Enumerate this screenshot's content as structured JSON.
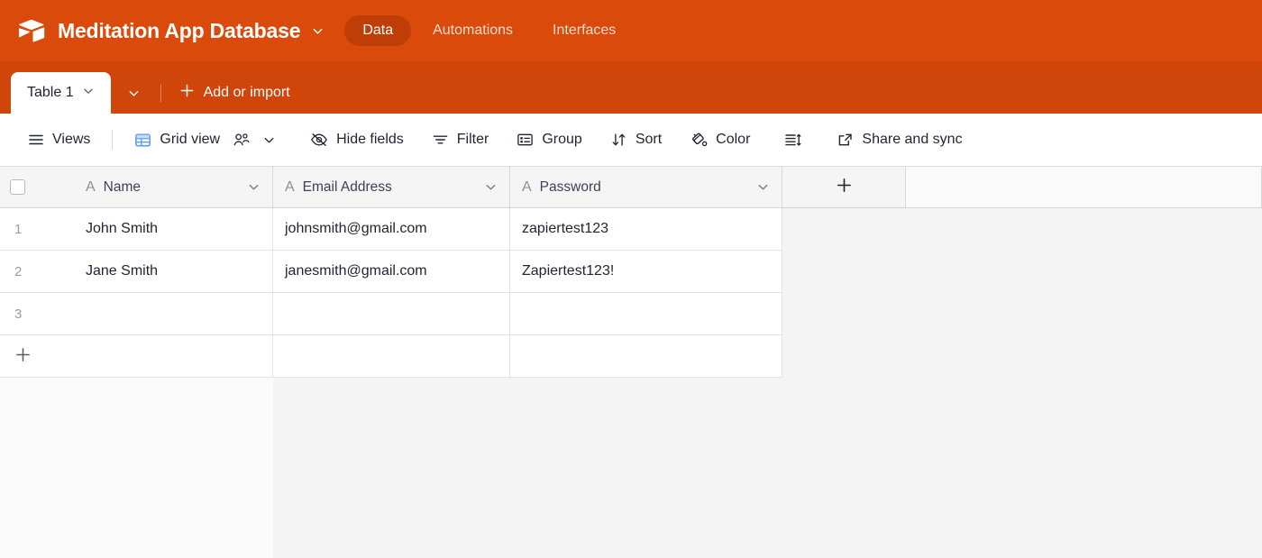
{
  "theme": {
    "brand_orange": "#d94a0b",
    "tabstrip_orange": "#cf450a",
    "active_pill": "#bf3d06",
    "grid_icon_blue": "#5b9bf0"
  },
  "appbar": {
    "logo_icon": "airtable-cube-icon",
    "base_title": "Meditation App Database",
    "base_caret_icon": "chevron-down-icon",
    "nav_items": [
      {
        "label": "Data",
        "active": true
      },
      {
        "label": "Automations",
        "active": false
      },
      {
        "label": "Interfaces",
        "active": false
      }
    ]
  },
  "tabstrip": {
    "table_tab_label": "Table 1",
    "table_tab_caret_icon": "chevron-down-icon",
    "tabstrip_caret_icon": "chevron-down-icon",
    "add_import_label": "Add or import",
    "add_import_icon": "plus-icon"
  },
  "toolbar": {
    "views_label": "Views",
    "views_icon": "hamburger-menu-icon",
    "grid_view_label": "Grid view",
    "grid_view_icon": "grid-table-icon",
    "collaborators_icon": "people-icon",
    "grid_view_caret_icon": "chevron-down-icon",
    "hide_fields_label": "Hide fields",
    "hide_fields_icon": "eye-slash-icon",
    "filter_label": "Filter",
    "filter_icon": "filter-icon",
    "group_label": "Group",
    "group_icon": "group-list-icon",
    "sort_label": "Sort",
    "sort_icon": "sort-arrows-icon",
    "color_label": "Color",
    "color_icon": "paint-bucket-icon",
    "row_height_icon": "row-height-icon",
    "share_sync_label": "Share and sync",
    "share_sync_icon": "external-link-icon"
  },
  "grid": {
    "select_all_checkbox": "unchecked",
    "add_field_icon": "plus-icon",
    "add_row_icon": "plus-icon",
    "columns": [
      {
        "name": "Name",
        "type_icon": "text-field-icon",
        "type_glyph": "A",
        "caret_icon": "chevron-down-icon"
      },
      {
        "name": "Email Address",
        "type_icon": "text-field-icon",
        "type_glyph": "A",
        "caret_icon": "chevron-down-icon"
      },
      {
        "name": "Password",
        "type_icon": "text-field-icon",
        "type_glyph": "A",
        "caret_icon": "chevron-down-icon"
      }
    ],
    "rows": [
      {
        "number": "1",
        "Name": "John Smith",
        "Email Address": "johnsmith@gmail.com",
        "Password": "zapiertest123"
      },
      {
        "number": "2",
        "Name": "Jane Smith",
        "Email Address": "janesmith@gmail.com",
        "Password": "Zapiertest123!"
      },
      {
        "number": "3",
        "Name": "",
        "Email Address": "",
        "Password": ""
      }
    ]
  }
}
